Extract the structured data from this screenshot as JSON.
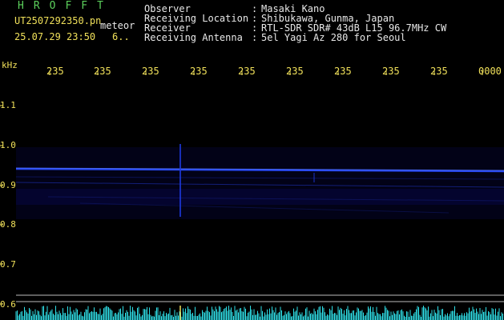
{
  "header": {
    "brand": "HROFFT",
    "filename": "UT2507292350.pn",
    "mode": "meteor",
    "timestamp": "25.07.29 23:50",
    "count": "6..",
    "meta": [
      {
        "key": "Observer",
        "sep": ":",
        "value": "Masaki Kano"
      },
      {
        "key": "Receiving Location",
        "sep": ":",
        "value": "Shibukawa, Gunma, Japan"
      },
      {
        "key": "Receiver",
        "sep": ":",
        "value": "RTL-SDR SDR# 43dB L15 96.7MHz CW"
      },
      {
        "key": "Receiving Antenna",
        "sep": ":",
        "value": "5el Yagi Az 280 for Seoul"
      }
    ]
  },
  "axes": {
    "y_unit": "kHz",
    "y_ticks": [
      "1.1",
      "1.0",
      "0.9",
      "0.8",
      "0.7",
      "0.6"
    ],
    "x_ticks": [
      "235",
      "235",
      "235",
      "235",
      "235",
      "235",
      "235",
      "235",
      "235",
      "0000"
    ]
  },
  "colors": {
    "background": "#000000",
    "label_green": "#5cd05c",
    "label_yellow": "#f0e05a",
    "signal_blue": "#2a4cff",
    "baseline_cyan": "#2fe0e8"
  }
}
